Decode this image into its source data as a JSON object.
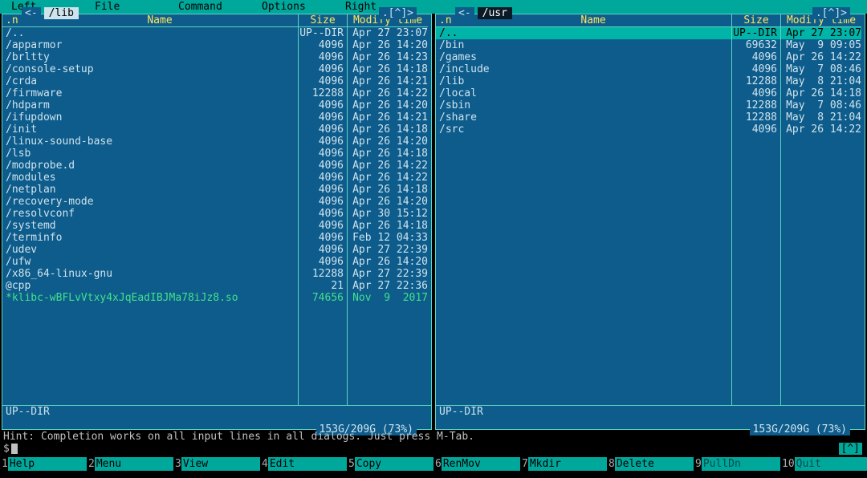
{
  "menu": [
    "Left",
    "File",
    "Command",
    "Options",
    "Right"
  ],
  "columns": {
    "name": "Name",
    "size": "Size",
    "mtime": "Modify time",
    "dot": ".n"
  },
  "sort_indicator": ".[^]>",
  "disk": "153G/209G (73%)",
  "left": {
    "path": "/lib",
    "mini": "UP--DIR",
    "files": [
      {
        "n": "/..",
        "s": "UP--DIR",
        "m": "Apr 27 23:07"
      },
      {
        "n": "/apparmor",
        "s": "4096",
        "m": "Apr 26 14:20"
      },
      {
        "n": "/brltty",
        "s": "4096",
        "m": "Apr 26 14:23"
      },
      {
        "n": "/console-setup",
        "s": "4096",
        "m": "Apr 26 14:18"
      },
      {
        "n": "/crda",
        "s": "4096",
        "m": "Apr 26 14:21"
      },
      {
        "n": "/firmware",
        "s": "12288",
        "m": "Apr 26 14:22"
      },
      {
        "n": "/hdparm",
        "s": "4096",
        "m": "Apr 26 14:20"
      },
      {
        "n": "/ifupdown",
        "s": "4096",
        "m": "Apr 26 14:21"
      },
      {
        "n": "/init",
        "s": "4096",
        "m": "Apr 26 14:18"
      },
      {
        "n": "/linux-sound-base",
        "s": "4096",
        "m": "Apr 26 14:20"
      },
      {
        "n": "/lsb",
        "s": "4096",
        "m": "Apr 26 14:18"
      },
      {
        "n": "/modprobe.d",
        "s": "4096",
        "m": "Apr 26 14:22"
      },
      {
        "n": "/modules",
        "s": "4096",
        "m": "Apr 26 14:22"
      },
      {
        "n": "/netplan",
        "s": "4096",
        "m": "Apr 26 14:18"
      },
      {
        "n": "/recovery-mode",
        "s": "4096",
        "m": "Apr 26 14:20"
      },
      {
        "n": "/resolvconf",
        "s": "4096",
        "m": "Apr 30 15:12"
      },
      {
        "n": "/systemd",
        "s": "4096",
        "m": "Apr 26 14:18"
      },
      {
        "n": "/terminfo",
        "s": "4096",
        "m": "Feb 12 04:33"
      },
      {
        "n": "/udev",
        "s": "4096",
        "m": "Apr 27 22:39"
      },
      {
        "n": "/ufw",
        "s": "4096",
        "m": "Apr 26 14:20"
      },
      {
        "n": "/x86_64-linux-gnu",
        "s": "12288",
        "m": "Apr 27 22:39"
      },
      {
        "n": "@cpp",
        "s": "21",
        "m": "Apr 27 22:36"
      },
      {
        "n": "*klibc-wBFLvVtxy4xJqEadIBJMa78iJz8.so",
        "s": "74656",
        "m": "Nov  9  2017",
        "exec": true
      }
    ]
  },
  "right": {
    "path": "/usr",
    "mini": "UP--DIR",
    "sel": 0,
    "files": [
      {
        "n": "/..",
        "s": "UP--DIR",
        "m": "Apr 27 23:07"
      },
      {
        "n": "/bin",
        "s": "69632",
        "m": "May  9 09:05"
      },
      {
        "n": "/games",
        "s": "4096",
        "m": "Apr 26 14:22"
      },
      {
        "n": "/include",
        "s": "4096",
        "m": "May  7 08:46"
      },
      {
        "n": "/lib",
        "s": "12288",
        "m": "May  8 21:04"
      },
      {
        "n": "/local",
        "s": "4096",
        "m": "Apr 26 14:18"
      },
      {
        "n": "/sbin",
        "s": "12288",
        "m": "May  7 08:46"
      },
      {
        "n": "/share",
        "s": "12288",
        "m": "May  8 21:04"
      },
      {
        "n": "/src",
        "s": "4096",
        "m": "Apr 26 14:22"
      }
    ]
  },
  "hint": "Hint: Completion works on all input lines in all dialogs. Just press M-Tab.",
  "prompt": "$ ",
  "caret": "[^]",
  "fkeys": [
    {
      "n": "1",
      "t": "Help"
    },
    {
      "n": "2",
      "t": "Menu"
    },
    {
      "n": "3",
      "t": "View"
    },
    {
      "n": "4",
      "t": "Edit"
    },
    {
      "n": "5",
      "t": "Copy"
    },
    {
      "n": "6",
      "t": "RenMov"
    },
    {
      "n": "7",
      "t": "Mkdir"
    },
    {
      "n": "8",
      "t": "Delete"
    },
    {
      "n": "9",
      "t": "PullDn",
      "dim": true
    },
    {
      "n": "10",
      "t": "Quit",
      "dim": true
    }
  ]
}
